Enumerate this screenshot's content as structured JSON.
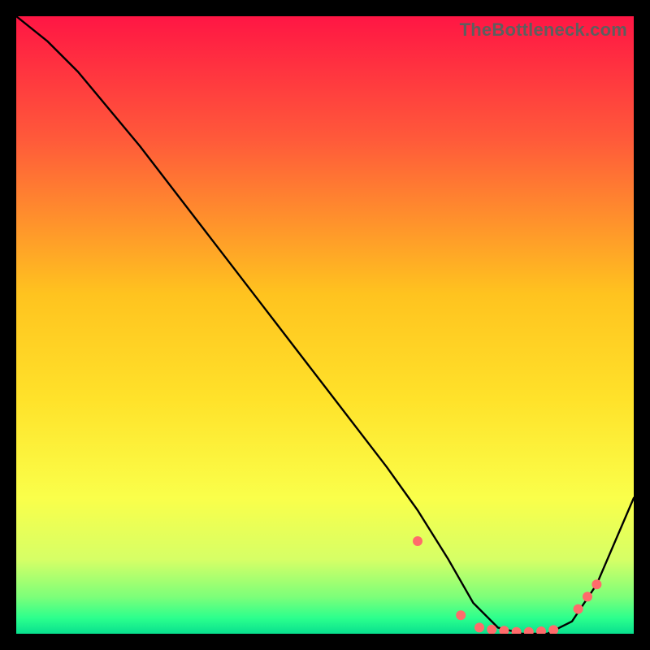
{
  "watermark": "TheBottleneck.com",
  "chart_data": {
    "type": "line",
    "title": "",
    "xlabel": "",
    "ylabel": "",
    "xlim": [
      0,
      100
    ],
    "ylim": [
      0,
      100
    ],
    "grid": false,
    "legend": false,
    "gradient_stops": [
      {
        "offset": 0,
        "color": "#ff1644"
      },
      {
        "offset": 0.2,
        "color": "#ff5a3a"
      },
      {
        "offset": 0.45,
        "color": "#ffc31f"
      },
      {
        "offset": 0.62,
        "color": "#ffe22a"
      },
      {
        "offset": 0.78,
        "color": "#faff4a"
      },
      {
        "offset": 0.88,
        "color": "#d6ff66"
      },
      {
        "offset": 0.94,
        "color": "#7dff79"
      },
      {
        "offset": 0.975,
        "color": "#2bff8d"
      },
      {
        "offset": 1.0,
        "color": "#08e08e"
      }
    ],
    "series": [
      {
        "name": "curve",
        "stroke": "#000000",
        "stroke_width": 2.4,
        "x": [
          0,
          5,
          10,
          20,
          30,
          40,
          50,
          60,
          65,
          70,
          74,
          78,
          82,
          86,
          90,
          94,
          100
        ],
        "y": [
          100,
          96,
          91,
          79,
          66,
          53,
          40,
          27,
          20,
          12,
          5,
          1,
          0,
          0,
          2,
          8,
          22
        ]
      }
    ],
    "markers": {
      "color": "#ff6b6b",
      "radius": 6,
      "x": [
        65,
        72,
        75,
        77,
        79,
        81,
        83,
        85,
        87,
        91,
        92.5,
        94
      ],
      "y": [
        15,
        3,
        1,
        0.7,
        0.5,
        0.3,
        0.3,
        0.4,
        0.6,
        4,
        6,
        8
      ]
    }
  }
}
